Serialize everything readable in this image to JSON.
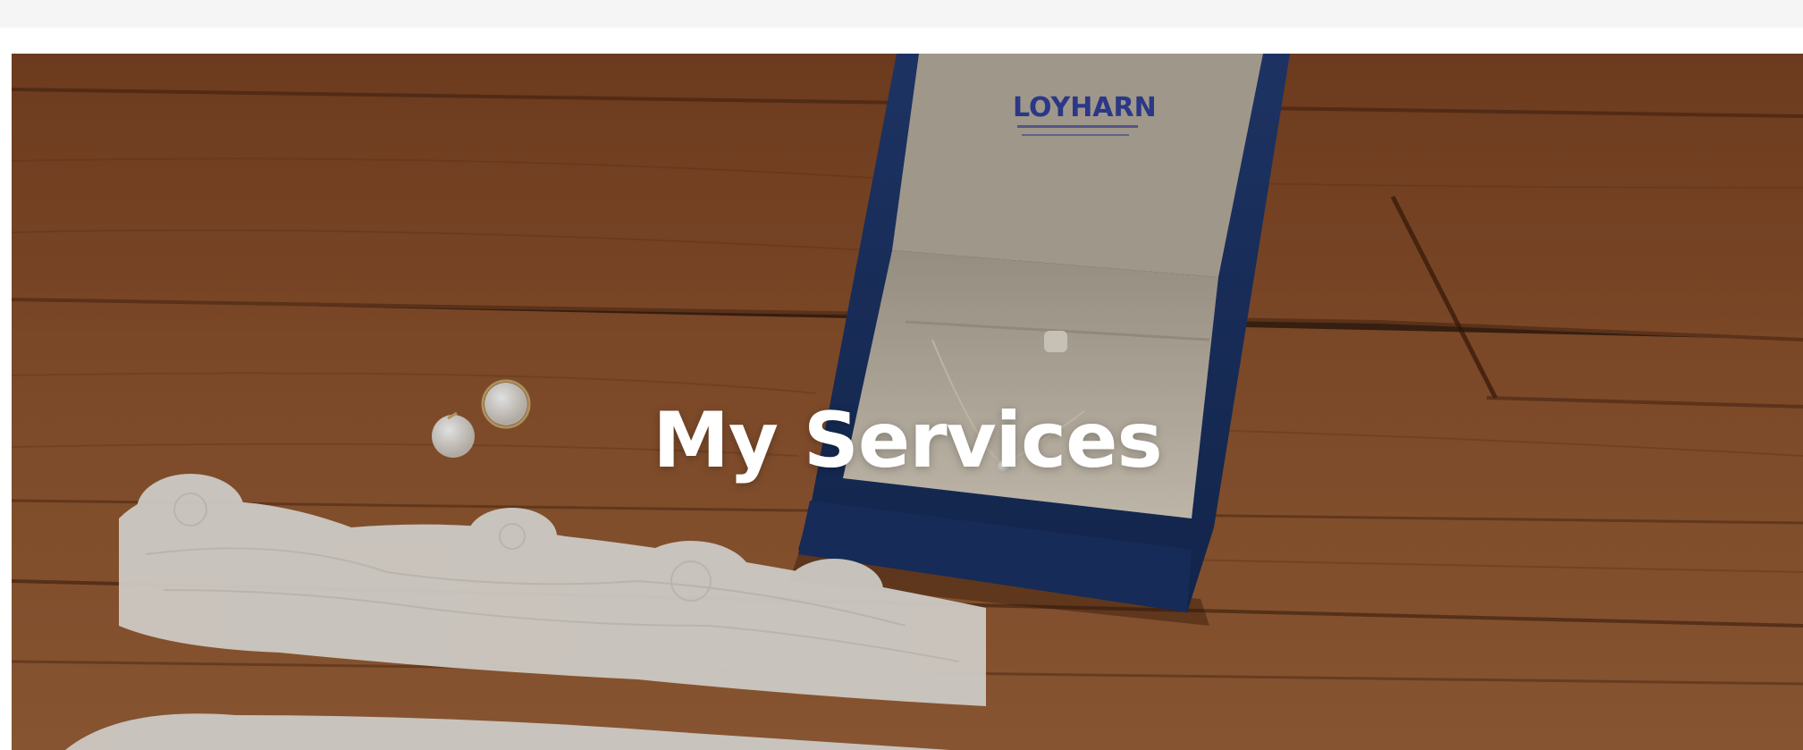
{
  "page": {
    "hero_title": "My Services"
  },
  "hero_image": {
    "subject": "jewelry-box-pearl-earrings-lace-garter-on-wood",
    "box_brand_text": "LOYHARN"
  },
  "colors": {
    "top_bar": "#f5f5f5",
    "wood": "#8a4f2a",
    "box_navy": "#1c3466",
    "box_inner": "#c9c0b0",
    "title_text": "#ffffff"
  }
}
